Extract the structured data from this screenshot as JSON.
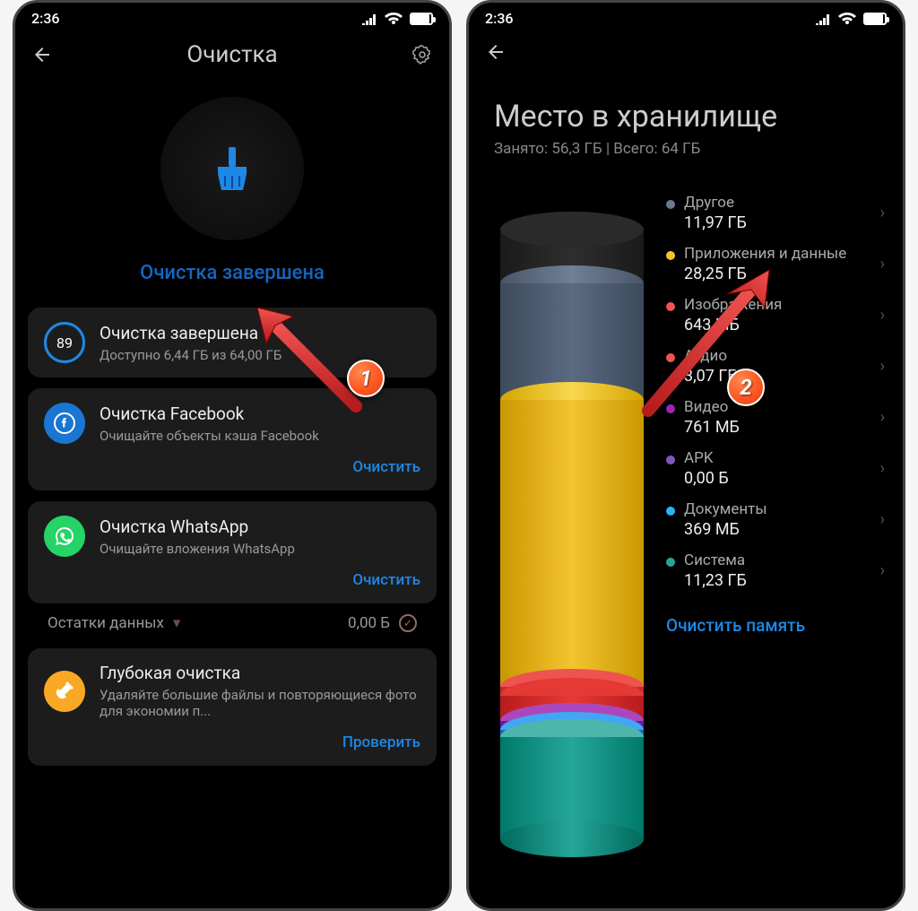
{
  "status": {
    "time": "2:36"
  },
  "screen1": {
    "title": "Очистка",
    "cleanDone": "Очистка завершена",
    "marker": "1",
    "cards": {
      "done": {
        "ring": "89",
        "title": "Очистка завершена",
        "sub": "Доступно 6,44 ГБ из 64,00 ГБ"
      },
      "fb": {
        "title": "Очистка Facebook",
        "sub": "Очищайте объекты кэша Facebook",
        "action": "Очистить"
      },
      "wa": {
        "title": "Очистка WhatsApp",
        "sub": "Очищайте вложения WhatsApp",
        "action": "Очистить"
      },
      "deep": {
        "title": "Глубокая очистка",
        "sub": "Удаляйте большие файлы и повторяющиеся фото для экономии п...",
        "action": "Проверить"
      }
    },
    "residual": {
      "label": "Остатки данных",
      "value": "0,00 Б"
    }
  },
  "screen2": {
    "title": "Место в хранилище",
    "sub": "Занято: 56,3 ГБ | Всего: 64 ГБ",
    "marker": "2",
    "cleanMem": "Очистить память",
    "legend": [
      {
        "name": "Другое",
        "value": "11,97 ГБ",
        "color": "#6b7a8f"
      },
      {
        "name": "Приложения и данные",
        "value": "28,25 ГБ",
        "color": "#f4c430"
      },
      {
        "name": "Изображения",
        "value": "643 МБ",
        "color": "#ef5350"
      },
      {
        "name": "Аудио",
        "value": "3,07 ГБ",
        "color": "#ef5350"
      },
      {
        "name": "Видео",
        "value": "761 МБ",
        "color": "#9c27b0"
      },
      {
        "name": "APK",
        "value": "0,00 Б",
        "color": "#7e57c2"
      },
      {
        "name": "Документы",
        "value": "369 МБ",
        "color": "#29b6f6"
      },
      {
        "name": "Система",
        "value": "11,23 ГБ",
        "color": "#26a69a"
      }
    ]
  },
  "chart_data": {
    "type": "bar",
    "title": "Место в хранилище",
    "categories": [
      "Другое",
      "Приложения и данные",
      "Изображения",
      "Аудио",
      "Видео",
      "APK",
      "Документы",
      "Система"
    ],
    "values_gb": [
      11.97,
      28.25,
      0.643,
      3.07,
      0.761,
      0.0,
      0.369,
      11.23
    ],
    "total_gb": 64,
    "used_gb": 56.3,
    "colors": [
      "#6b7a8f",
      "#f4c430",
      "#ef5350",
      "#ef5350",
      "#9c27b0",
      "#7e57c2",
      "#29b6f6",
      "#26a69a"
    ]
  }
}
